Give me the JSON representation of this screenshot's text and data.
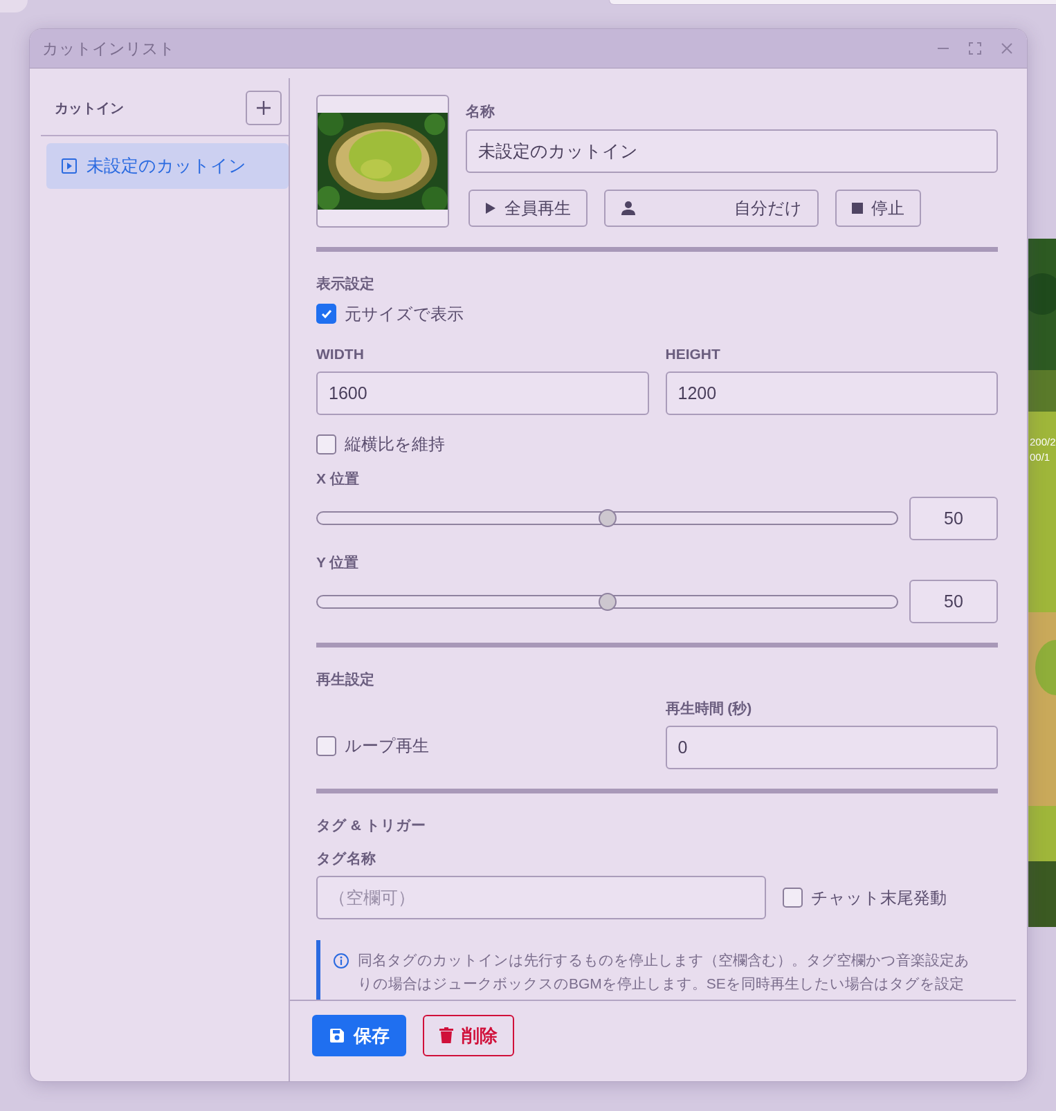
{
  "window": {
    "title": "カットインリスト"
  },
  "sidebar": {
    "title": "カットイン",
    "items": [
      {
        "label": "未設定のカットイン",
        "selected": true
      }
    ]
  },
  "editor": {
    "name_label": "名称",
    "name_value": "未設定のカットイン",
    "play_buttons": [
      {
        "kind": "play",
        "label": "全員再生"
      },
      {
        "kind": "self",
        "label": "自分だけ"
      },
      {
        "kind": "stop",
        "label": "停止"
      }
    ],
    "display": {
      "heading": "表示設定",
      "original_size": {
        "label": "元サイズで表示",
        "checked": true
      },
      "width": {
        "label": "WIDTH",
        "value": "1600"
      },
      "height": {
        "label": "HEIGHT",
        "value": "1200"
      },
      "keep_ratio": {
        "label": "縦横比を維持",
        "checked": false
      },
      "sliders": [
        {
          "label": "X 位置",
          "level": 0.5,
          "value": "50"
        },
        {
          "label": "Y 位置",
          "level": 0.5,
          "value": "50"
        }
      ]
    },
    "playback": {
      "heading": "再生設定",
      "loop": {
        "label": "ループ再生",
        "checked": false
      },
      "duration": {
        "label": "再生時間 (秒)",
        "value": "0"
      }
    },
    "tags": {
      "heading": "タグ & トリガー",
      "tag_label": "タグ名称",
      "tag_placeholder": "（空欄可）",
      "chat_trigger": {
        "label": "チャット末尾発動",
        "checked": false
      },
      "info": "同名タグのカットインは先行するものを停止します（空欄含む）。タグ空欄かつ音楽設定ありの場合はジュークボックスのBGMを停止します。SEを同時再生したい場合はタグを設定"
    }
  },
  "footer_buttons": [
    {
      "kind": "save",
      "label": "保存"
    },
    {
      "kind": "delete",
      "label": "削除"
    }
  ],
  "background": {
    "labels": [
      "200/2",
      "00/1"
    ]
  }
}
